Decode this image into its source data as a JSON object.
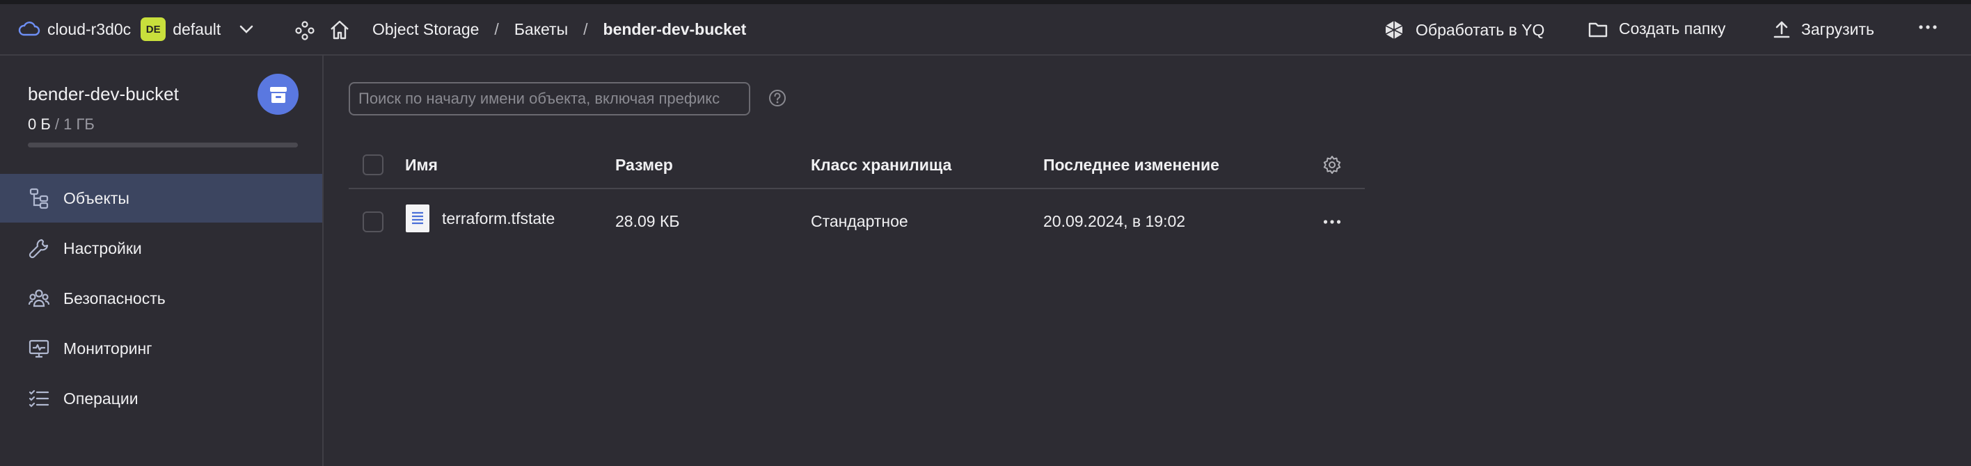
{
  "topbar": {
    "cloud_name": "cloud-r3d0c",
    "folder_badge": "DE",
    "folder_name": "default",
    "breadcrumbs": [
      "Object Storage",
      "Бакеты",
      "bender-dev-bucket"
    ],
    "separator": "/",
    "actions": {
      "process_yq": "Обработать в YQ",
      "create_folder": "Создать папку",
      "upload": "Загрузить"
    }
  },
  "sidebar": {
    "bucket_name": "bender-dev-bucket",
    "usage_used": "0 Б",
    "usage_limit": "/ 1 ГБ",
    "usage_fraction": 0,
    "items": [
      {
        "label": "Объекты",
        "icon": "objects-tree-icon",
        "active": true
      },
      {
        "label": "Настройки",
        "icon": "wrench-icon",
        "active": false
      },
      {
        "label": "Безопасность",
        "icon": "users-icon",
        "active": false
      },
      {
        "label": "Мониторинг",
        "icon": "monitor-chart-icon",
        "active": false
      },
      {
        "label": "Операции",
        "icon": "list-check-icon",
        "active": false
      }
    ]
  },
  "main": {
    "search_placeholder": "Поиск по началу имени объекта, включая префикс",
    "table": {
      "columns": [
        "Имя",
        "Размер",
        "Класс хранилища",
        "Последнее изменение"
      ],
      "rows": [
        {
          "name": "terraform.tfstate",
          "size": "28.09 КБ",
          "storage_class": "Стандартное",
          "modified": "20.09.2024, в 19:02"
        }
      ]
    }
  },
  "colors": {
    "background": "#2d2c33",
    "active_nav": "#3c4560",
    "accent": "#5a78e0",
    "folder_badge": "#c8df3c"
  }
}
